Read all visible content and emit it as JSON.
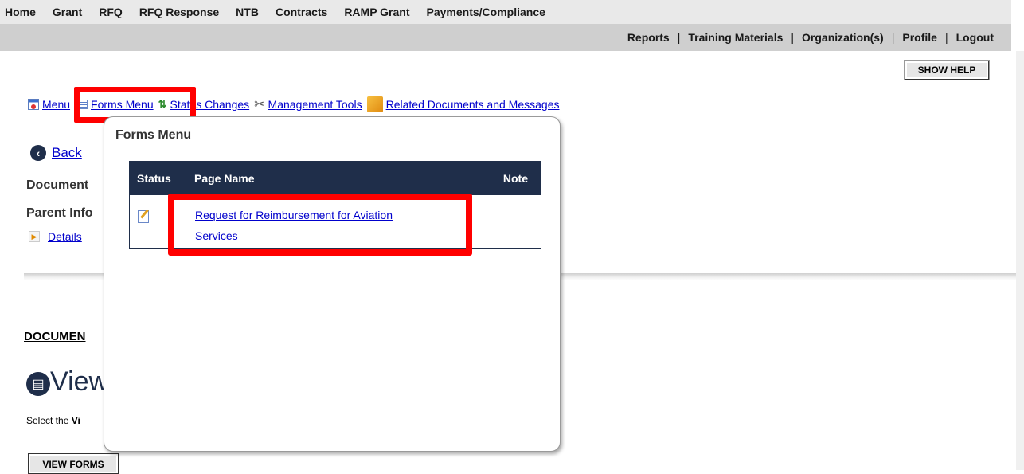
{
  "topnav": {
    "main": [
      "Home",
      "Grant",
      "RFQ",
      "RFQ Response",
      "NTB",
      "Contracts",
      "RAMP Grant",
      "Payments/Compliance"
    ],
    "secondary": [
      "Reports",
      "Training Materials",
      "Organization(s)",
      "Profile",
      "Logout"
    ],
    "separator": "|"
  },
  "help_button": "SHOW HELP",
  "toolbar": {
    "menu": "Menu",
    "forms_menu": "Forms Menu",
    "status_changes": "Status Changes",
    "management_tools": "Management Tools",
    "related_docs": "Related Documents and Messages"
  },
  "back": {
    "label": "Back"
  },
  "document_label": "Document",
  "parent_info_label": "Parent Info",
  "details_link": "Details",
  "documents_heading": "DOCUMEN",
  "view_title": "View",
  "select_text": {
    "prefix": "Select the ",
    "bold": "Vi"
  },
  "view_forms_button": "VIEW FORMS",
  "popup": {
    "title": "Forms Menu",
    "columns": {
      "status": "Status",
      "page_name": "Page Name",
      "note": "Note"
    },
    "rows": [
      {
        "page_name": "Request for Reimbursement for Aviation Services",
        "note": ""
      }
    ]
  },
  "annotation_color": "#ff0000",
  "header_color": "#1f2e4a"
}
